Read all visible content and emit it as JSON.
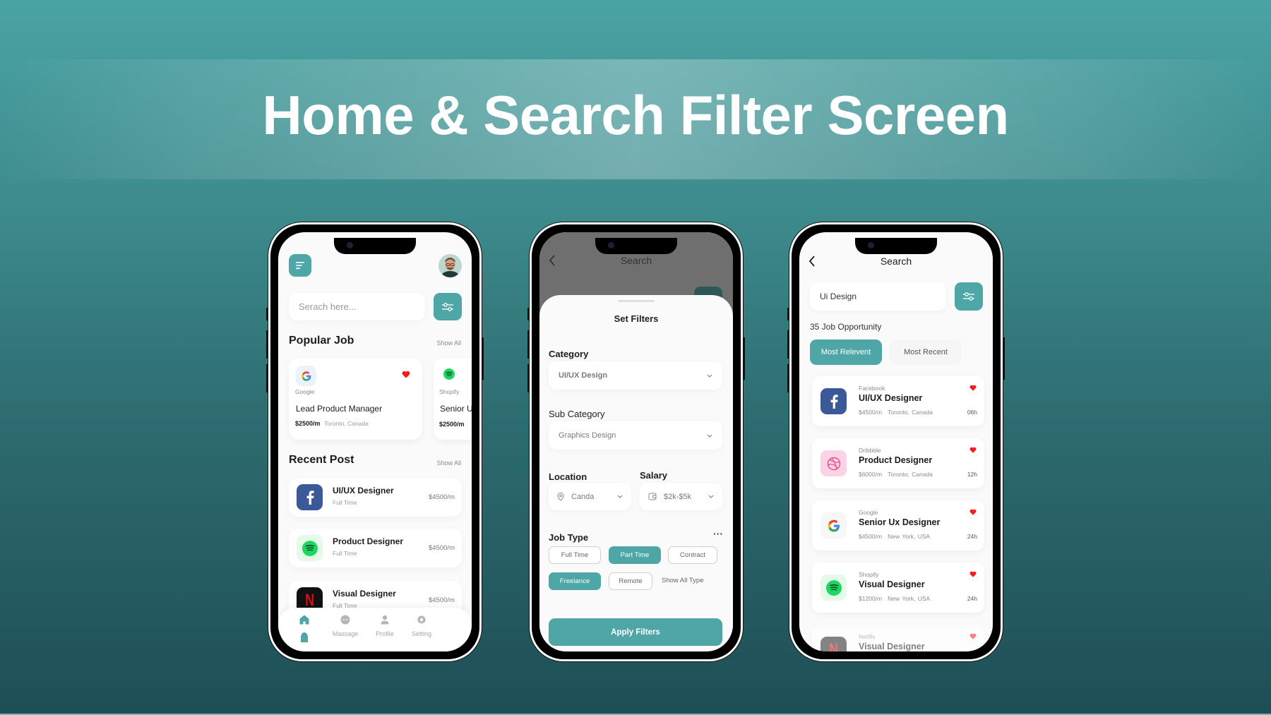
{
  "page": {
    "title": "Home & Search Filter Screen"
  },
  "colors": {
    "accent": "#4fa6a6",
    "heart": "#ff1a1a",
    "facebook": "#3b5998",
    "spotify": "#1ed760",
    "netflix": "#e50914",
    "dribbble": "#ea4c89"
  },
  "home": {
    "menu_icon": "menu-icon",
    "avatar_icon": "user-avatar",
    "search_placeholder": "Serach here...",
    "filter_icon": "sliders-icon",
    "popular": {
      "title": "Popular Job",
      "show_all": "Show All",
      "cards": [
        {
          "company": "Google",
          "role": "Lead Product Manager",
          "salary": "$2500/m",
          "location": "Toronto, Canada",
          "favorited": true
        },
        {
          "company": "Shopify",
          "role": "Senior U",
          "salary": "$2500/m",
          "location": "",
          "favorited": false
        }
      ]
    },
    "recent": {
      "title": "Recent Post",
      "show_all": "Show All",
      "items": [
        {
          "company": "Facebook",
          "role": "UI/UX Designer",
          "type": "Full Time",
          "salary": "$4500/m"
        },
        {
          "company": "Spotify",
          "role": "Product Designer",
          "type": "Full Time",
          "salary": "$4500/m"
        },
        {
          "company": "Netflix",
          "role": "Visual Designer",
          "type": "Full Time",
          "salary": "$4500/m"
        }
      ]
    },
    "nav": [
      {
        "label": "",
        "icon": "home-icon",
        "active": true
      },
      {
        "label": "Massage",
        "icon": "chat-icon",
        "active": false
      },
      {
        "label": "Profile",
        "icon": "profile-icon",
        "active": false
      },
      {
        "label": "Setting",
        "icon": "gear-icon",
        "active": false
      }
    ]
  },
  "filters": {
    "header_title": "Search",
    "sheet_title": "Set Filters",
    "category_label": "Category",
    "category_value": "UI/UX Design",
    "subcategory_label": "Sub Category",
    "subcategory_value": "Graphics Design",
    "location_label": "Location",
    "location_value": "Canda",
    "salary_label": "Salary",
    "salary_value": "$2k-$5k",
    "job_type_label": "Job Type",
    "more_label": "···",
    "job_types": [
      {
        "label": "Full Time",
        "selected": false
      },
      {
        "label": "Part Time",
        "selected": true
      },
      {
        "label": "Contract",
        "selected": false
      },
      {
        "label": "Freelance",
        "selected": true
      },
      {
        "label": "Remote",
        "selected": false
      }
    ],
    "show_all_type": "Show All Type",
    "apply_label": "Apply Filters"
  },
  "search": {
    "title": "Search",
    "query": "Ui Design",
    "result_count": "35 Job Opportunity",
    "tabs": [
      {
        "label": "Most Relevent",
        "active": true
      },
      {
        "label": "Most Recent",
        "active": false
      }
    ],
    "results": [
      {
        "company": "Facebook",
        "role": "UI/UX Designer",
        "salary": "$4500/m",
        "location": "Toronto, Canada",
        "age": "06h",
        "favorited": true
      },
      {
        "company": "Dribbble",
        "role": "Product Designer",
        "salary": "$6000/m",
        "location": "Toronto, Canada",
        "age": "12h",
        "favorited": true
      },
      {
        "company": "Google",
        "role": "Senior Ux Designer",
        "salary": "$4500/m",
        "location": "New York, USA",
        "age": "24h",
        "favorited": true
      },
      {
        "company": "Shopify",
        "role": "Visual Designer",
        "salary": "$1200/m",
        "location": "New York, USA",
        "age": "24h",
        "favorited": true
      },
      {
        "company": "Netflix",
        "role": "Visual Designer",
        "salary": "",
        "location": "",
        "age": "",
        "favorited": true
      }
    ]
  }
}
